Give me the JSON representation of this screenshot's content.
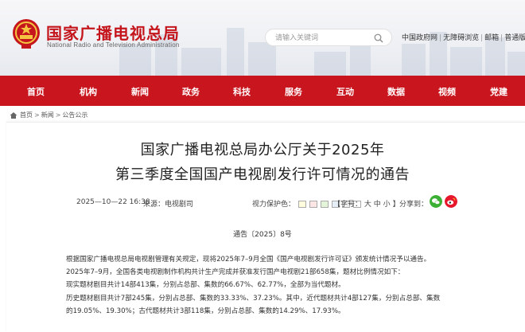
{
  "header": {
    "title": "国家广播电视总局",
    "subtitle": "National Radio and Television Administration",
    "search_placeholder": "请输入关键词",
    "links": [
      "中国政府网",
      "无障碍浏览",
      "邮箱",
      "普通版"
    ]
  },
  "colors": {
    "brand_red": "#c9151e",
    "title_red": "#c4161c"
  },
  "nav": {
    "items": [
      "首页",
      "机构",
      "新闻",
      "政务",
      "科技",
      "服务",
      "互动",
      "数据",
      "视频",
      "党建"
    ]
  },
  "breadcrumb": [
    "首页",
    "新闻",
    "公告公示"
  ],
  "article": {
    "title_line1": "国家广播电视总局办公厅关于2025年",
    "title_line2": "第三季度全国国产电视剧发行许可情况的通告",
    "date": "2025—10—22 16:38",
    "source": "来源：电视剧司",
    "protect_label": "视力保护色：",
    "protect_colors": [
      "#fefedf",
      "#fce6e6",
      "#e3f4d8",
      "#e6eef8",
      "#eeeeee",
      "#ffffff"
    ],
    "font_label": "【字号：",
    "font_sizes": [
      "大",
      "中",
      "小"
    ],
    "font_end": "】",
    "share_label": "分享到：",
    "doc_number": "通告〔2025〕8号",
    "paragraphs": [
      "根据国家广播电视总局电视剧管理有关规定，现将2025年7–9月全国《国产电视剧发行许可证》颁发统计情况予以通告。",
      "2025年7–9月，全国各类电视剧制作机构共计生产完成并获准发行国产电视剧21部658集，题材比例情况如下：",
      "现实题材剧目共计14部413集，分别占总部、集数的66.67%、62.77%，全部为当代题材。",
      "历史题材剧目共计7部245集，分别占总部、集数的33.33%、37.23%。其中，近代题材共计4部127集，分别占总部、集数",
      "的19.05%、19.30%；古代题材共计3部118集，分别占总部、集数的14.29%、17.93%。"
    ]
  }
}
